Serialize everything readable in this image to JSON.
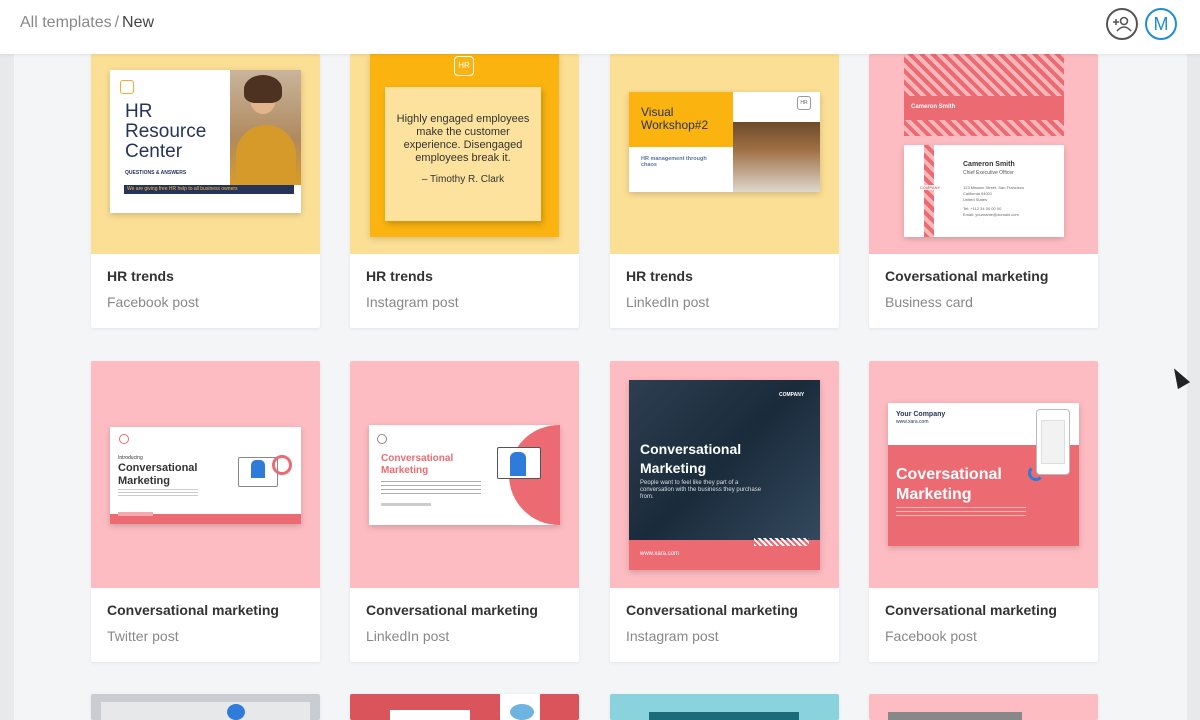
{
  "breadcrumb": {
    "root": "All templates",
    "separator": "/",
    "current": "New"
  },
  "header": {
    "avatar_letter": "M"
  },
  "cards": [
    {
      "title": "HR trends",
      "subtitle": "Facebook post",
      "bg": "#fbdf95"
    },
    {
      "title": "HR trends",
      "subtitle": "Instagram post",
      "bg": "#fbdf95"
    },
    {
      "title": "HR trends",
      "subtitle": "LinkedIn post",
      "bg": "#fbdf95"
    },
    {
      "title": "Coversational marketing",
      "subtitle": "Business card",
      "bg": "#fdbcc1"
    },
    {
      "title": "Conversational marketing",
      "subtitle": "Twitter post",
      "bg": "#fdbcc1"
    },
    {
      "title": "Conversational marketing",
      "subtitle": "LinkedIn post",
      "bg": "#fdbcc1"
    },
    {
      "title": "Conversational marketing",
      "subtitle": "Instagram post",
      "bg": "#fdbcc1"
    },
    {
      "title": "Conversational marketing",
      "subtitle": "Facebook post",
      "bg": "#fdbcc1"
    }
  ],
  "thumbs": {
    "hr_fb": {
      "line1": "HR",
      "line2": "Resource",
      "line3": "Center",
      "tag": "QUESTIONS & ANSWERS",
      "band": "We are giving free HR help to all business owners"
    },
    "hr_ig": {
      "quote": "Highly engaged employees make the customer experience. Disengaged employees break it.",
      "author": "– Timothy R. Clark",
      "logo": "HR"
    },
    "hr_li": {
      "title1": "Visual",
      "title2": "Workshop#2",
      "sub": "HR management through chaos",
      "logo": "HR"
    },
    "bc": {
      "name_top": "Cameron Smith",
      "name": "Cameron Smith",
      "role": "Chief Executive Officer",
      "addr1": "123 Mission Street, San Francisco",
      "addr2": "California 94001",
      "addr3": "United States",
      "tel": "Tel: +112 34 00 00 00",
      "email": "Email: yourname@domain.com",
      "brand": "COMPANY"
    },
    "tw": {
      "intro": "Introducing",
      "h1": "Conversational",
      "h2": "Marketing"
    },
    "li": {
      "h1": "Conversational",
      "h2": "Marketing"
    },
    "ig": {
      "h1": "Conversational",
      "h2": "Marketing",
      "body": "People want to feel like they part of a conversation with the business they purchase from.",
      "url": "www.xara.com",
      "brand": "COMPANY"
    },
    "fb": {
      "company": "Your Company",
      "url": "www.xara.com",
      "h1": "Coversational",
      "h2": "Marketing"
    }
  },
  "colors": {
    "accent": "#1f8dd6",
    "pink": "#ec6b72",
    "navy": "#26345b",
    "yellow": "#fbdf95"
  }
}
